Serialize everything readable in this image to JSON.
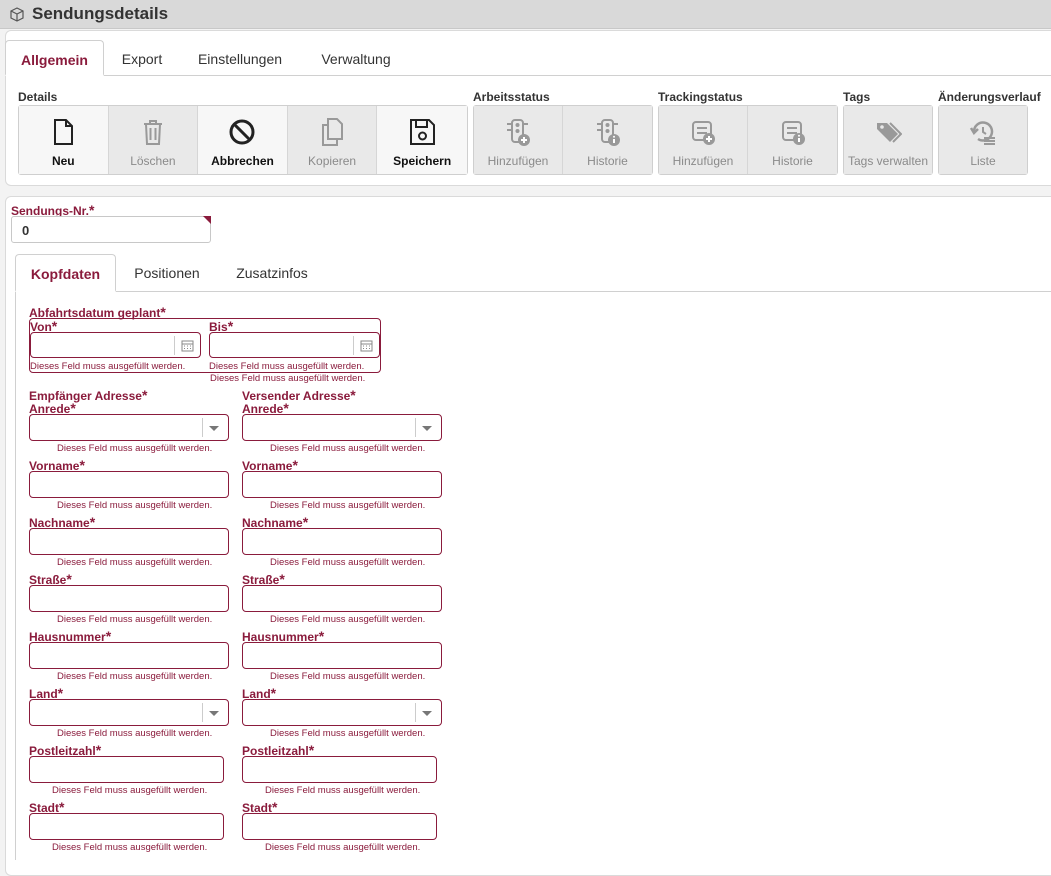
{
  "window": {
    "title": "Sendungsdetails",
    "icon": "package-icon"
  },
  "main_tabs": [
    {
      "label": "Allgemein",
      "active": true
    },
    {
      "label": "Export"
    },
    {
      "label": "Einstellungen"
    },
    {
      "label": "Verwaltung"
    }
  ],
  "toolbar": {
    "groups": [
      {
        "label": "Details",
        "buttons": [
          {
            "label": "Neu",
            "icon": "file-icon",
            "enabled": true
          },
          {
            "label": "Löschen",
            "icon": "trash-icon",
            "enabled": false
          },
          {
            "label": "Abbrechen",
            "icon": "cancel-icon",
            "enabled": true
          },
          {
            "label": "Kopieren",
            "icon": "copy-icon",
            "enabled": false
          },
          {
            "label": "Speichern",
            "icon": "save-icon",
            "enabled": true
          }
        ]
      },
      {
        "label": "Arbeitsstatus",
        "buttons": [
          {
            "label": "Hinzufügen",
            "icon": "traffic-light-add-icon",
            "enabled": false
          },
          {
            "label": "Historie",
            "icon": "traffic-light-info-icon",
            "enabled": false
          }
        ]
      },
      {
        "label": "Trackingstatus",
        "buttons": [
          {
            "label": "Hinzufügen",
            "icon": "truck-add-icon",
            "enabled": false
          },
          {
            "label": "Historie",
            "icon": "truck-info-icon",
            "enabled": false
          }
        ]
      },
      {
        "label": "Tags",
        "buttons": [
          {
            "label": "Tags verwalten",
            "icon": "tags-icon",
            "enabled": false
          }
        ]
      },
      {
        "label": "Änderungsverlauf",
        "buttons": [
          {
            "label": "Liste",
            "icon": "history-list-icon",
            "enabled": false
          }
        ]
      }
    ]
  },
  "shipment": {
    "label": "Sendungs-Nr.",
    "value": "0"
  },
  "sub_tabs": [
    {
      "label": "Kopfdaten",
      "active": true
    },
    {
      "label": "Positionen"
    },
    {
      "label": "Zusatzinfos"
    }
  ],
  "form": {
    "required_mark": "*",
    "error_text": "Dieses Feld muss ausgefüllt werden.",
    "departure": {
      "label": "Abfahrtsdatum geplant",
      "from_label": "Von",
      "to_label": "Bis"
    },
    "recipient": {
      "heading": "Empfänger Adresse",
      "fields": [
        "Anrede",
        "Vorname",
        "Nachname",
        "Straße",
        "Hausnummer",
        "Land",
        "Postleitzahl",
        "Stadt"
      ]
    },
    "sender": {
      "heading": "Versender Adresse",
      "fields": [
        "Anrede",
        "Vorname",
        "Nachname",
        "Straße",
        "Hausnummer",
        "Land",
        "Postleitzahl",
        "Stadt"
      ]
    }
  },
  "colors": {
    "accent": "#8a1b3c",
    "titlebar": "#d9d9d9"
  }
}
